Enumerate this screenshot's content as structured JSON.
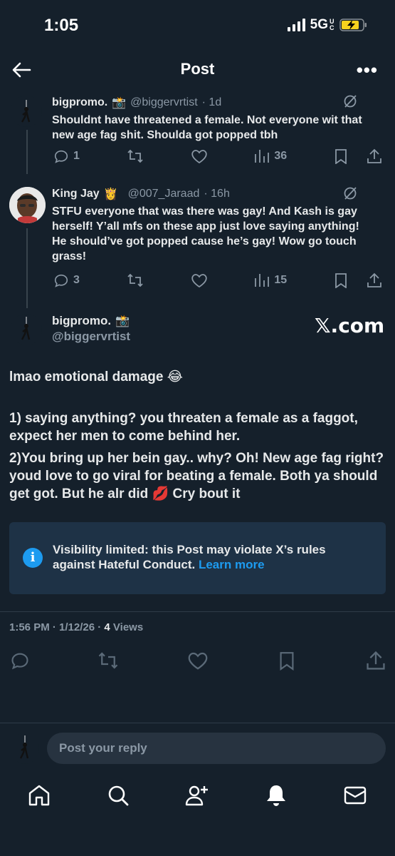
{
  "status_bar": {
    "time": "1:05",
    "network": "5G",
    "uc": "UC"
  },
  "header": {
    "title": "Post"
  },
  "replies": [
    {
      "name": "bigpromo.",
      "emoji": "📸",
      "handle": "@biggervrtist",
      "time": "· 1d",
      "text": "Shouldnt have threatened a female. Not everyone wit that new age fag shit. Shoulda got popped tbh",
      "stats": {
        "replies": "1",
        "views": "36"
      }
    },
    {
      "name": "King Jay",
      "emoji": "👸",
      "handle": "@007_Jaraad",
      "time": "· 16h",
      "text": "STFU everyone that was there was gay! And Kash is gay herself! Y’all mfs on these app just love saying anything! He should’ve got popped cause he’s gay! Wow go touch grass!",
      "stats": {
        "replies": "3",
        "views": "15"
      }
    }
  ],
  "main_post": {
    "name": "bigpromo.",
    "emoji": "📸",
    "handle": "@biggervrtist",
    "watermark": "𝕏.com",
    "line1": "lmao emotional damage 😂",
    "line2": "1) saying anything? you threaten a female as a faggot, expect her men to come behind her.",
    "line3": "2)You bring up her bein gay.. why? Oh! New age fag right? youd love to go viral for beating a female. Both ya should get got. But he alr did 💋 Cry bout it",
    "notice": {
      "text": "Visibility limited: this Post may violate X’s rules against Hateful Conduct.",
      "link": "Learn more"
    },
    "timestamp": "1:56 PM · 1/12/26 · ",
    "views_count": "4",
    "views_label": "Views"
  },
  "reply_input": {
    "placeholder": "Post your reply"
  },
  "colors": {
    "background": "#15202b",
    "accent": "#1d9bf0",
    "muted": "#8b98a5",
    "notice_bg": "#1e3246",
    "battery": "#f7d21e"
  },
  "icons": [
    "back-arrow-icon",
    "more-icon",
    "grok-icon",
    "reply-icon",
    "repost-icon",
    "like-icon",
    "views-icon",
    "bookmark-icon",
    "share-icon",
    "info-icon",
    "home-icon",
    "search-icon",
    "people-icon",
    "bell-icon",
    "mail-icon"
  ]
}
